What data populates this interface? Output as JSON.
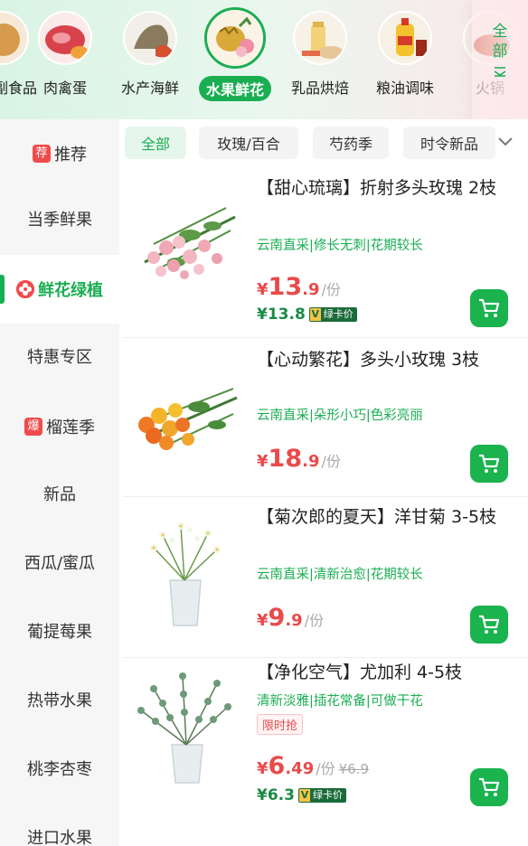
{
  "top_categories": [
    {
      "label": "副食品",
      "icon": "snack-icon"
    },
    {
      "label": "肉禽蛋",
      "icon": "meat-icon"
    },
    {
      "label": "水产海鲜",
      "icon": "seafood-icon"
    },
    {
      "label": "水果鲜花",
      "icon": "fruit-flower-icon",
      "active": true
    },
    {
      "label": "乳品烘焙",
      "icon": "dairy-icon"
    },
    {
      "label": "粮油调味",
      "icon": "grain-oil-icon"
    },
    {
      "label": "火锅",
      "icon": "hotpot-icon"
    }
  ],
  "all_button": {
    "chars": [
      "全",
      "部"
    ]
  },
  "sidebar": {
    "items": [
      {
        "label": "推荐",
        "tag": "荐"
      },
      {
        "label": "当季鲜果"
      },
      {
        "label": "鲜花绿植",
        "active": true
      },
      {
        "label": "特惠专区"
      },
      {
        "label": "榴莲季",
        "tag": "爆"
      },
      {
        "label": "新品"
      },
      {
        "label": "西瓜/蜜瓜"
      },
      {
        "label": "葡提莓果"
      },
      {
        "label": "热带水果"
      },
      {
        "label": "桃李杏枣"
      },
      {
        "label": "进口水果"
      }
    ]
  },
  "filters": [
    "全部",
    "玫瑰/百合",
    "芍药季",
    "时令新品"
  ],
  "products": [
    {
      "title": "【甜心琉璃】折射多头玫瑰 2枝",
      "tags": "云南直采|修长无刺|花期较长",
      "price_yen": "¥",
      "price_int": "13",
      "price_dec": ".9",
      "unit": "/份",
      "member_price": "¥13.8",
      "member_badge": "绿卡价",
      "image": "pink-rose-bouquet"
    },
    {
      "title": "【心动繁花】多头小玫瑰 3枝",
      "tags": "云南直采|朵形小巧|色彩亮丽",
      "price_yen": "¥",
      "price_int": "18",
      "price_dec": ".9",
      "unit": "/份",
      "image": "orange-rose-bouquet"
    },
    {
      "title": "【菊次郎的夏天】洋甘菊 3-5枝",
      "tags": "云南直采|清新治愈|花期较长",
      "price_yen": "¥",
      "price_int": "9",
      "price_dec": ".9",
      "unit": "/份",
      "image": "chamomile-vase"
    },
    {
      "title": "【净化空气】尤加利 4-5枝",
      "tags": "清新淡雅|插花常备|可做干花",
      "promo": "限时抢",
      "price_yen": "¥",
      "price_int": "6",
      "price_dec": ".49",
      "unit": "/份",
      "orig_price": "¥6.9",
      "member_price": "¥6.3",
      "member_badge": "绿卡价",
      "image": "eucalyptus-vase"
    }
  ],
  "colors": {
    "accent": "#1aae52",
    "price": "#e94a4a",
    "cart": "#1ab34e"
  }
}
